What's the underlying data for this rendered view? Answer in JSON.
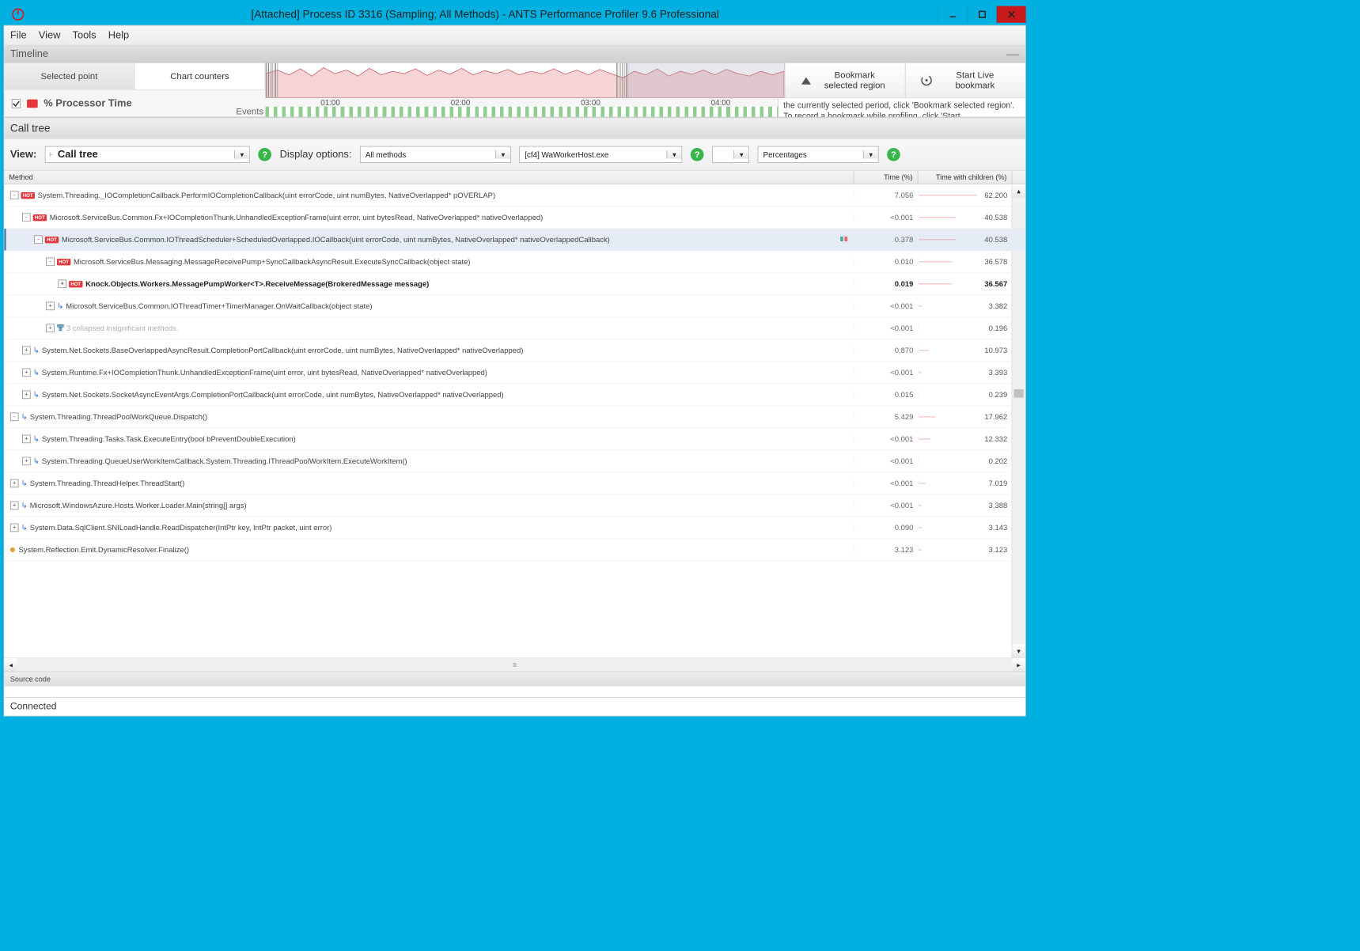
{
  "window": {
    "title": "[Attached] Process ID 3316 (Sampling; All Methods) - ANTS Performance Profiler 9.6 Professional"
  },
  "menu": {
    "file": "File",
    "view": "View",
    "tools": "Tools",
    "help": "Help"
  },
  "timeline": {
    "header": "Timeline",
    "tab_selected": "Selected point",
    "tab_counters": "Chart counters",
    "counter_label": "% Processor Time",
    "events_label": "Events",
    "bookmark_btn": "Bookmark selected region",
    "live_btn": "Start Live bookmark",
    "hint": "the currently selected period, click 'Bookmark selected region'. To record a bookmark while profiling, click 'Start",
    "ticks": [
      "01:00",
      "02:00",
      "03:00",
      "04:00"
    ]
  },
  "calltree": {
    "header": "Call tree",
    "view_label": "View:",
    "view_value": "Call tree",
    "display_label": "Display options:",
    "opt_methods": "All methods",
    "opt_process": "[cf4] WaWorkerHost.exe",
    "opt_empty": "",
    "opt_units": "Percentages",
    "col_method": "Method",
    "col_time": "Time (%)",
    "col_twc": "Time with children (%)"
  },
  "rows": [
    {
      "indent": 0,
      "toggle": "-",
      "hot": true,
      "txt": "System.Threading._IOCompletionCallback.PerformIOCompletionCallback(uint errorCode, uint numBytes, NativeOverlapped* pOVERLAP)",
      "time": "7.056",
      "twc": "62.200",
      "bar": 62
    },
    {
      "indent": 1,
      "toggle": "-",
      "hot": true,
      "txt": "Microsoft.ServiceBus.Common.Fx+IOCompletionThunk.UnhandledExceptionFrame(uint error, uint bytesRead, NativeOverlapped* nativeOverlapped)",
      "time": "<0.001",
      "twc": "40.538",
      "bar": 40
    },
    {
      "indent": 2,
      "toggle": "-",
      "hot": true,
      "txt": "Microsoft.ServiceBus.Common.IOThreadScheduler+ScheduledOverlapped.IOCallback(uint errorCode, uint numBytes, NativeOverlapped* nativeOverlappedCallback)",
      "time": "0.378",
      "twc": "40.538",
      "bar": 40,
      "sel": true,
      "spark": true
    },
    {
      "indent": 3,
      "toggle": "-",
      "hot": true,
      "txt": "Microsoft.ServiceBus.Messaging.MessageReceivePump+SyncCallbackAsyncResult.ExecuteSyncCallback(object state)",
      "time": "0.010",
      "twc": "36.578",
      "bar": 36
    },
    {
      "indent": 4,
      "toggle": "+",
      "hot": true,
      "txt": "Knock.Objects.Workers.MessagePumpWorker<T>.ReceiveMessage(BrokeredMessage message)",
      "time": "0.019",
      "twc": "36.567",
      "bar": 36,
      "bold": true
    },
    {
      "indent": 3,
      "toggle": "+",
      "arrow": true,
      "txt": "Microsoft.ServiceBus.Common.IOThreadTimer+TimerManager.OnWaitCallback(object state)",
      "time": "<0.001",
      "twc": "3.382",
      "bar": 3
    },
    {
      "indent": 3,
      "toggle": "+",
      "filter": true,
      "txt": "3 collapsed insignificant methods.",
      "time": "<0.001",
      "twc": "0.196",
      "bar": 0,
      "grey": true
    },
    {
      "indent": 1,
      "toggle": "+",
      "arrow": true,
      "txt": "System.Net.Sockets.BaseOverlappedAsyncResult.CompletionPortCallback(uint errorCode, uint numBytes, NativeOverlapped* nativeOverlapped)",
      "time": "0.870",
      "twc": "10.973",
      "bar": 11
    },
    {
      "indent": 1,
      "toggle": "+",
      "arrow": true,
      "txt": "System.Runtime.Fx+IOCompletionThunk.UnhandledExceptionFrame(uint error, uint bytesRead, NativeOverlapped* nativeOverlapped)",
      "time": "<0.001",
      "twc": "3.393",
      "bar": 3
    },
    {
      "indent": 1,
      "toggle": "+",
      "arrow": true,
      "txt": "System.Net.Sockets.SocketAsyncEventArgs.CompletionPortCallback(uint errorCode, uint numBytes, NativeOverlapped* nativeOverlapped)",
      "time": "0.015",
      "twc": "0.239",
      "bar": 0
    },
    {
      "indent": 0,
      "toggle": "-",
      "arrow": true,
      "txt": "System.Threading.ThreadPoolWorkQueue.Dispatch()",
      "time": "5.429",
      "twc": "17.962",
      "bar": 18
    },
    {
      "indent": 1,
      "toggle": "+",
      "arrow": true,
      "txt": "System.Threading.Tasks.Task.ExecuteEntry(bool bPreventDoubleExecution)",
      "time": "<0.001",
      "twc": "12.332",
      "bar": 12
    },
    {
      "indent": 1,
      "toggle": "+",
      "arrow": true,
      "txt": "System.Threading.QueueUserWorkItemCallback.System.Threading.IThreadPoolWorkItem.ExecuteWorkItem()",
      "time": "<0.001",
      "twc": "0.202",
      "bar": 0
    },
    {
      "indent": 0,
      "toggle": "+",
      "arrow": true,
      "txt": "System.Threading.ThreadHelper.ThreadStart()",
      "time": "<0.001",
      "twc": "7.019",
      "bar": 7
    },
    {
      "indent": 0,
      "toggle": "+",
      "arrow": true,
      "txt": "Microsoft.WindowsAzure.Hosts.Worker.Loader.Main(string[] args)",
      "time": "<0.001",
      "twc": "3.388",
      "bar": 3
    },
    {
      "indent": 0,
      "toggle": "+",
      "arrow": true,
      "txt": "System.Data.SqlClient.SNILoadHandle.ReadDispatcher(IntPtr key, IntPtr packet, uint error)",
      "time": "0.090",
      "twc": "3.143",
      "bar": 3
    },
    {
      "indent": 0,
      "toggle": "",
      "dot": true,
      "txt": "System.Reflection.Emit.DynamicResolver.Finalize()",
      "time": "3.123",
      "twc": "3.123",
      "bar": 3
    }
  ],
  "source_header": "Source code",
  "status": "Connected"
}
